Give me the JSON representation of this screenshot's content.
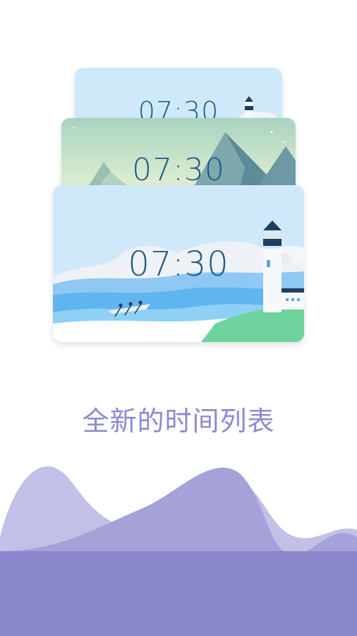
{
  "cards": [
    {
      "time": "07:30",
      "theme": "lighthouse-snow"
    },
    {
      "time": "07:30",
      "theme": "mountains"
    },
    {
      "time": "07:30",
      "theme": "lighthouse-sea"
    }
  ],
  "caption": "全新的时间列表",
  "colors": {
    "caption": "#8c89d4",
    "time": "#1f5a86",
    "wave_front": "#8a87cc",
    "wave_back": "#c2c0e6"
  }
}
